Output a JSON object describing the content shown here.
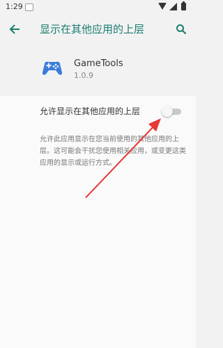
{
  "status_bar": {
    "time": "1:29"
  },
  "app_bar": {
    "title": "显示在其他应用的上层",
    "back_icon": "arrow-back-icon",
    "search_icon": "search-icon"
  },
  "app_info": {
    "name": "GameTools",
    "version": "1.0.9",
    "icon": "gamepad-icon"
  },
  "setting": {
    "label": "允许显示在其他应用的上层",
    "enabled": false
  },
  "description": "允许此应用显示在您当前使用的其他应用的上层。这可能会干扰您使用相关应用，或变更这类应用的显示或运行方式。",
  "colors": {
    "accent": "#1a7d6f",
    "annotation_arrow": "#e53935"
  }
}
